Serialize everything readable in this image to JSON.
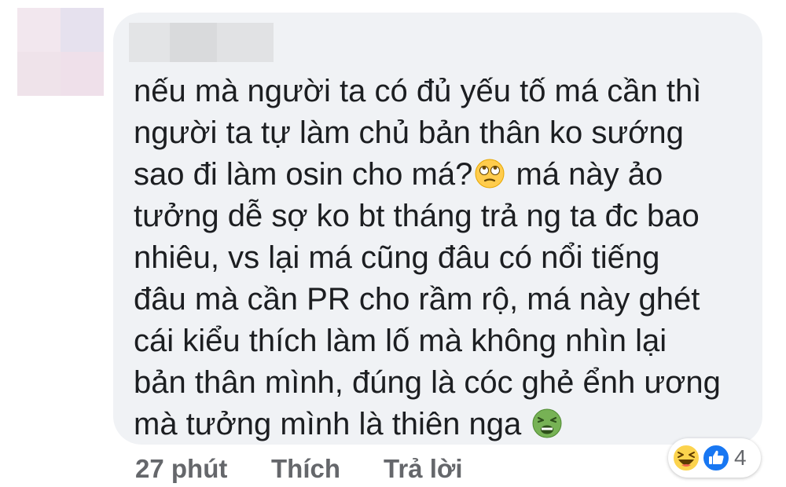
{
  "comment": {
    "line1": "nếu mà người ta có đủ yếu tố má cần thì",
    "line2": "người ta tự làm chủ bản thân ko sướng",
    "line3_before": "sao đi làm osin cho má?",
    "line3_after": " má này ảo",
    "line4": "tưởng dễ sợ ko bt tháng trả ng ta đc bao",
    "line5": "nhiêu, vs lại má cũng đâu có nổi tiếng",
    "line6": "đâu mà cần PR cho rầm rộ, má này ghét",
    "line7": "cái kiểu thích làm lố mà không nhìn lại",
    "line8": "bản thân mình, đúng là cóc ghẻ ểnh ương",
    "line9_before": "mà tưởng mình là thiên nga "
  },
  "emojis": {
    "first": "face-with-rolling-eyes-icon",
    "second": "nauseated-face-icon"
  },
  "actions": {
    "time": "27 phút",
    "like": "Thích",
    "reply": "Trả lời"
  },
  "reactions": {
    "icons": [
      "haha-reaction-icon",
      "like-reaction-icon"
    ],
    "count": "4"
  },
  "colors": {
    "bubble": "#f0f2f5",
    "text": "#1c1e21",
    "meta": "#65676b",
    "like_blue": "#1877f2"
  }
}
